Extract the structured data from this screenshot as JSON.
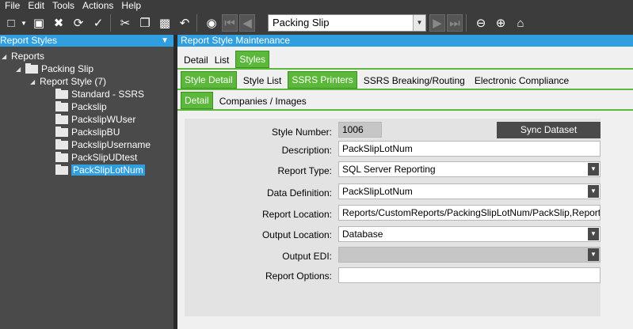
{
  "menu": [
    "File",
    "Edit",
    "Tools",
    "Actions",
    "Help"
  ],
  "toolbar": {
    "combo_value": "Packing Slip"
  },
  "left_panel": {
    "title": "Report Styles",
    "tree": {
      "root": "Reports",
      "level1": "Packing Slip",
      "level2": "Report Style (7)",
      "items": [
        "Standard - SSRS",
        "Packslip",
        "PackslipWUser",
        "PackslipBU",
        "PackslipUsername",
        "PackSlipUDtest",
        "PackSlipLotNum"
      ],
      "selected": "PackSlipLotNum"
    }
  },
  "main": {
    "title": "Report Style Maintenance",
    "tabs": [
      "Detail",
      "List",
      "Styles"
    ],
    "active_tab": "Styles",
    "subtabs": [
      "Style Detail",
      "Style List",
      "SSRS Printers",
      "SSRS Breaking/Routing",
      "Electronic Compliance"
    ],
    "active_subtab": "Style Detail",
    "subtabs2": [
      "Detail",
      "Companies / Images"
    ],
    "active_subtab2": "Detail",
    "form": {
      "style_number_label": "Style Number:",
      "style_number": "1006",
      "sync_label": "Sync Dataset",
      "description_label": "Description:",
      "description": "PackSlipLotNum",
      "report_type_label": "Report Type:",
      "report_type": "SQL Server Reporting",
      "data_definition_label": "Data Definition:",
      "data_definition": "PackSlipLotNum",
      "report_location_label": "Report Location:",
      "report_location": "Reports/CustomReports/PackingSlipLotNum/PackSlip,Reports/",
      "output_location_label": "Output Location:",
      "output_location": "Database",
      "output_edi_label": "Output EDI:",
      "output_edi": "",
      "report_options_label": "Report Options:",
      "report_options": ""
    }
  }
}
